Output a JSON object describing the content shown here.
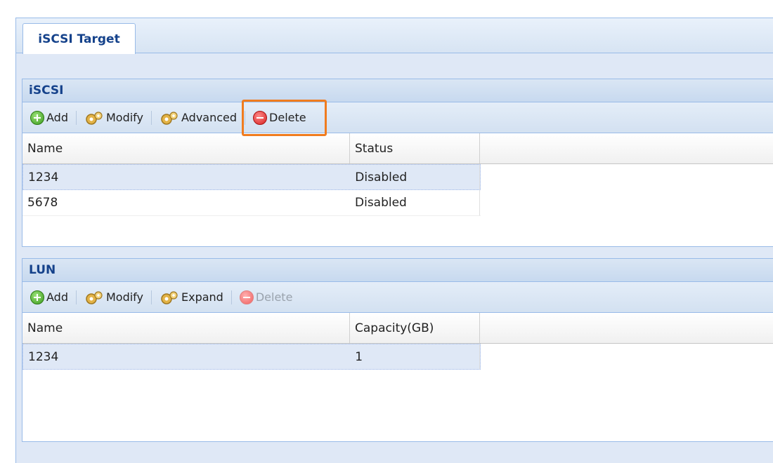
{
  "tab": {
    "label": "iSCSI Target"
  },
  "iscsi": {
    "title": "iSCSI",
    "toolbar": {
      "add": "Add",
      "modify": "Modify",
      "advanced": "Advanced",
      "delete": "Delete"
    },
    "columns": [
      "Name",
      "Status"
    ],
    "rows": [
      {
        "name": "1234",
        "status": "Disabled"
      },
      {
        "name": "5678",
        "status": "Disabled"
      }
    ]
  },
  "lun": {
    "title": "LUN",
    "toolbar": {
      "add": "Add",
      "modify": "Modify",
      "expand": "Expand",
      "delete": "Delete"
    },
    "columns": [
      "Name",
      "Capacity(GB)"
    ],
    "rows": [
      {
        "name": "1234",
        "capacity": "1"
      }
    ]
  },
  "colors": {
    "highlight": "#f07c1f",
    "panel_header_text": "#15428b",
    "selected_row": "#dfe8f6"
  }
}
